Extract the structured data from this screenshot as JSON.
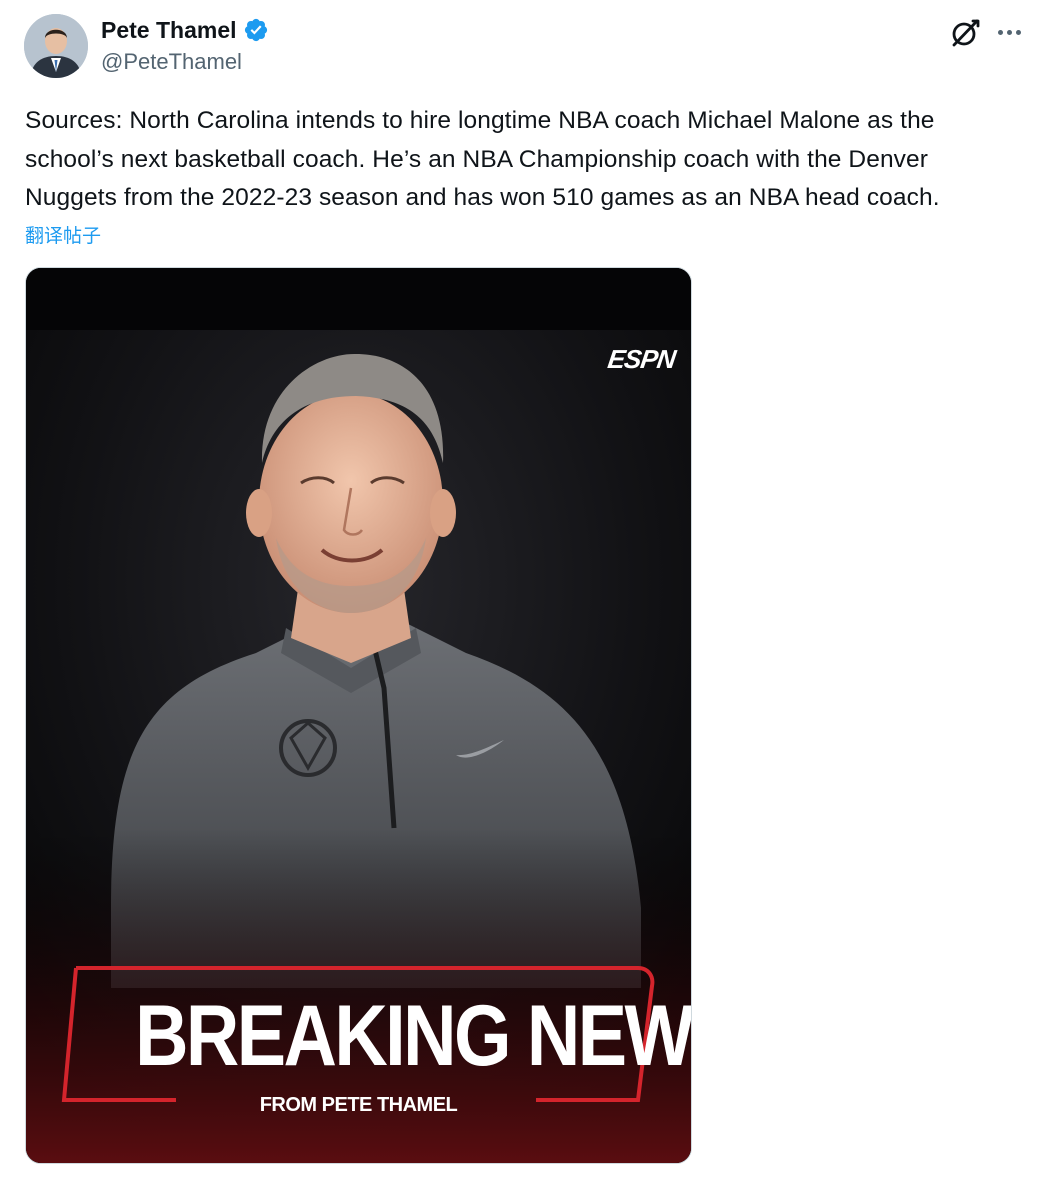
{
  "author": {
    "display_name": "Pete Thamel",
    "handle": "@PeteThamel",
    "verified": true,
    "avatar_icon": "profile-photo"
  },
  "actions": {
    "grok_icon": "grok-icon",
    "more_icon": "more-icon"
  },
  "tweet": {
    "text": "Sources: North Carolina intends to hire longtime NBA coach Michael Malone as the\nschool’s next basketball coach. He’s an NBA Championship coach with the Denver\nNuggets from the 2022-23 season and has won 510 games as an NBA head coach.",
    "translate_label": "翻译帖子"
  },
  "media": {
    "brand": "ESPN",
    "headline": "BREAKING NEWS",
    "subline": "FROM PETE THAMEL"
  },
  "colors": {
    "accent": "#1d9bf0",
    "verified_badge": "#1d9bf0",
    "graphic_red": "#d4242c",
    "graphic_bg": "#0b0b0d"
  }
}
